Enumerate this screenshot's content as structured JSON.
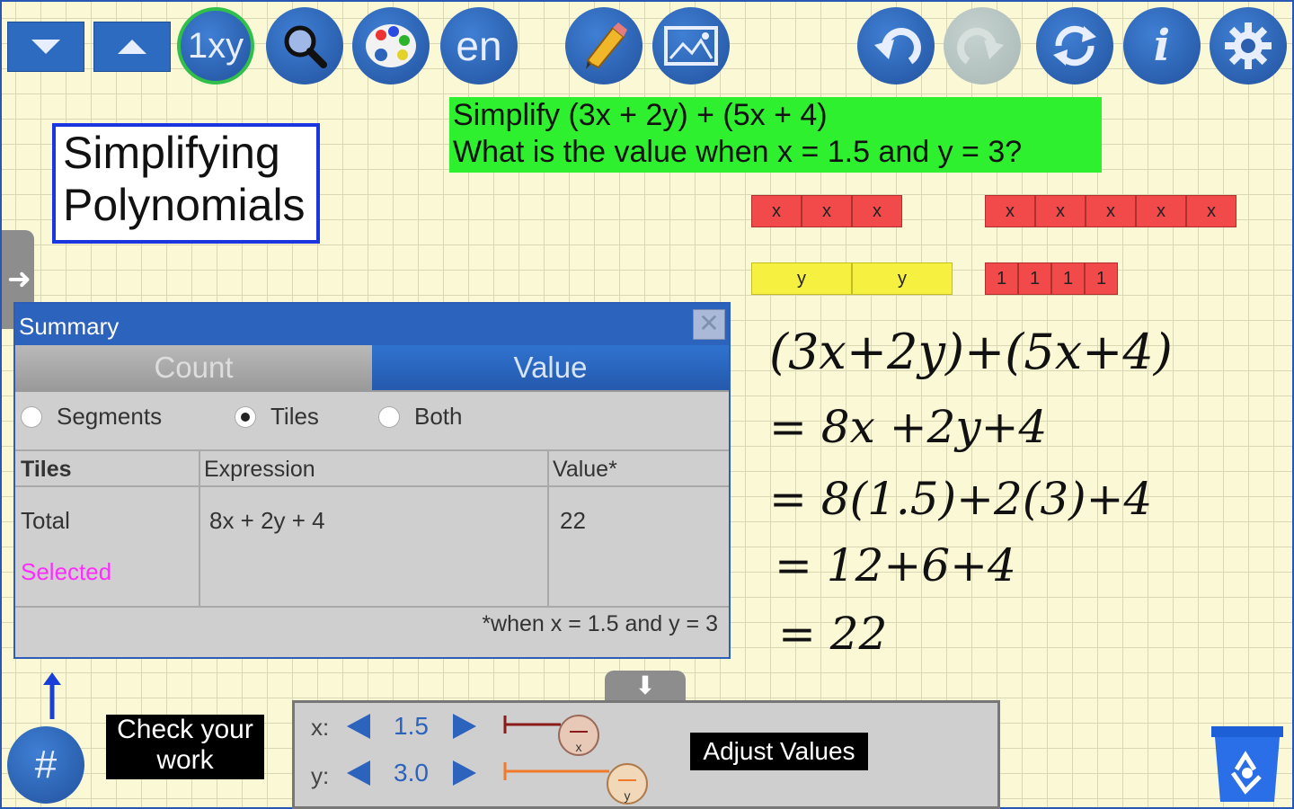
{
  "toolbar": {
    "scroll_down": "scroll-down",
    "scroll_up": "scroll-up",
    "variables_label": "1xy",
    "language_label": "en",
    "colors": {
      "button": "#2c6bbf",
      "selected_ring": "#2fbf4a",
      "disabled": "#b7c5c2"
    }
  },
  "title": {
    "line1": "Simplifying",
    "line2": "Polynomials"
  },
  "prompt": {
    "line1": "Simplify (3x + 2y) + (5x + 4)",
    "line2": "What is the value when x = 1.5 and y = 3?",
    "color": "#2ef02e"
  },
  "tiles": {
    "group1_x": [
      "x",
      "x",
      "x"
    ],
    "group2_x": [
      "x",
      "x",
      "x",
      "x",
      "x"
    ],
    "group1_y": [
      "y",
      "y"
    ],
    "group2_ones": [
      "1",
      "1",
      "1",
      "1"
    ]
  },
  "summary": {
    "title": "Summary",
    "close": "✕",
    "tabs": {
      "count": "Count",
      "value": "Value"
    },
    "radios": {
      "segments": "Segments",
      "tiles": "Tiles",
      "both": "Both",
      "selected": "Tiles"
    },
    "headers": {
      "tiles": "Tiles",
      "expression": "Expression",
      "value": "Value*"
    },
    "rows": {
      "total_label": "Total",
      "total_expression": "8x + 2y + 4",
      "total_value": "22",
      "selected_label": "Selected"
    },
    "footnote": "*when x = 1.5 and y = 3"
  },
  "work": {
    "line1": "(3x+2y)+(5x+4)",
    "line2": "= 8x +2y+4",
    "line3": "= 8(1.5)+2(3)+4",
    "line4": "= 12+6+4",
    "line5": "= 22"
  },
  "bottom": {
    "check_line1": "Check your",
    "check_line2": "work",
    "hash_label": "#",
    "adjust_label": "Adjust Values",
    "x_label": "x:",
    "x_value": "1.5",
    "y_label": "y:",
    "y_value": "3.0",
    "x_handle": "x",
    "y_handle": "y"
  }
}
